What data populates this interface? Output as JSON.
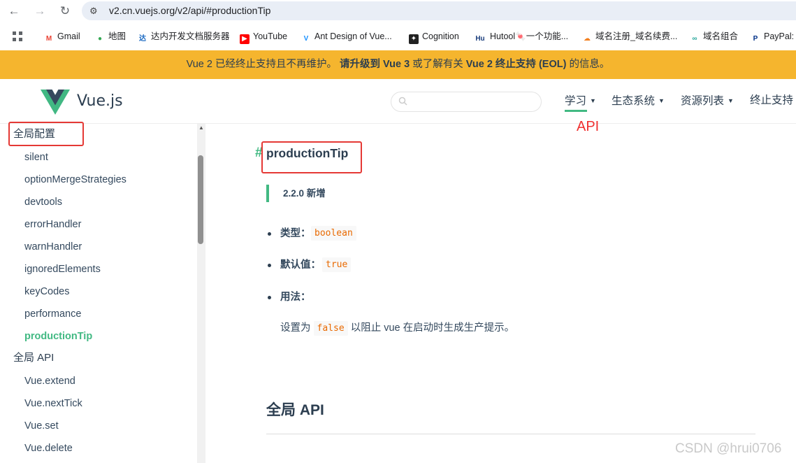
{
  "browser": {
    "url": "v2.cn.vuejs.org/v2/api/#productionTip",
    "bookmarks": [
      {
        "label": "Gmail",
        "icon": "gmail-icon"
      },
      {
        "label": "地图",
        "icon": "maps-icon"
      },
      {
        "label": "达内开发文档服务器",
        "icon": "tarena-icon"
      },
      {
        "label": "YouTube",
        "icon": "youtube-icon"
      },
      {
        "label": "Ant Design of Vue...",
        "icon": "antdv-icon"
      },
      {
        "label": "Cognition",
        "icon": "cognition-icon"
      },
      {
        "label": "Hutool🍬一个功能...",
        "icon": "hutool-icon"
      },
      {
        "label": "域名注册_域名续费...",
        "icon": "cloudflare-icon"
      },
      {
        "label": "域名组合",
        "icon": "domain-combo-icon"
      },
      {
        "label": "PayPal: S",
        "icon": "paypal-icon"
      }
    ]
  },
  "banner": {
    "text_part1": "Vue 2 已经终止支持且不再维护。",
    "text_bold1": "请升级到 Vue 3",
    "text_part2": "或了解有关",
    "text_bold2": "Vue 2 终止支持 (EOL)",
    "text_part3": "的信息。"
  },
  "header": {
    "logo_text": "Vue.js",
    "search_placeholder": "",
    "nav": [
      {
        "label": "学习"
      },
      {
        "label": "生态系统"
      },
      {
        "label": "资源列表"
      },
      {
        "label": "终止支持"
      }
    ]
  },
  "sidebar": {
    "section1": "全局配置",
    "items1": [
      "silent",
      "optionMergeStrategies",
      "devtools",
      "errorHandler",
      "warnHandler",
      "ignoredElements",
      "keyCodes",
      "performance",
      "productionTip"
    ],
    "active": "productionTip",
    "section2": "全局 API",
    "items2": [
      "Vue.extend",
      "Vue.nextTick",
      "Vue.set",
      "Vue.delete"
    ]
  },
  "content": {
    "anchor": "#",
    "heading": "productionTip",
    "tip": "2.2.0 新增",
    "type_label": "类型：",
    "type_value": "boolean",
    "default_label": "默认值：",
    "default_value": "true",
    "usage_label": "用法：",
    "usage_desc_1": "设置为",
    "usage_code": "false",
    "usage_desc_2": "以阻止 vue 在启动时生成生产提示。",
    "next_heading": "全局 API"
  },
  "annotations": {
    "api_label": "API",
    "color": "#e53935"
  },
  "watermark": "CSDN @hrui0706",
  "colors": {
    "accent": "#42b983",
    "banner": "#f5b52e",
    "code": "#e96900"
  }
}
